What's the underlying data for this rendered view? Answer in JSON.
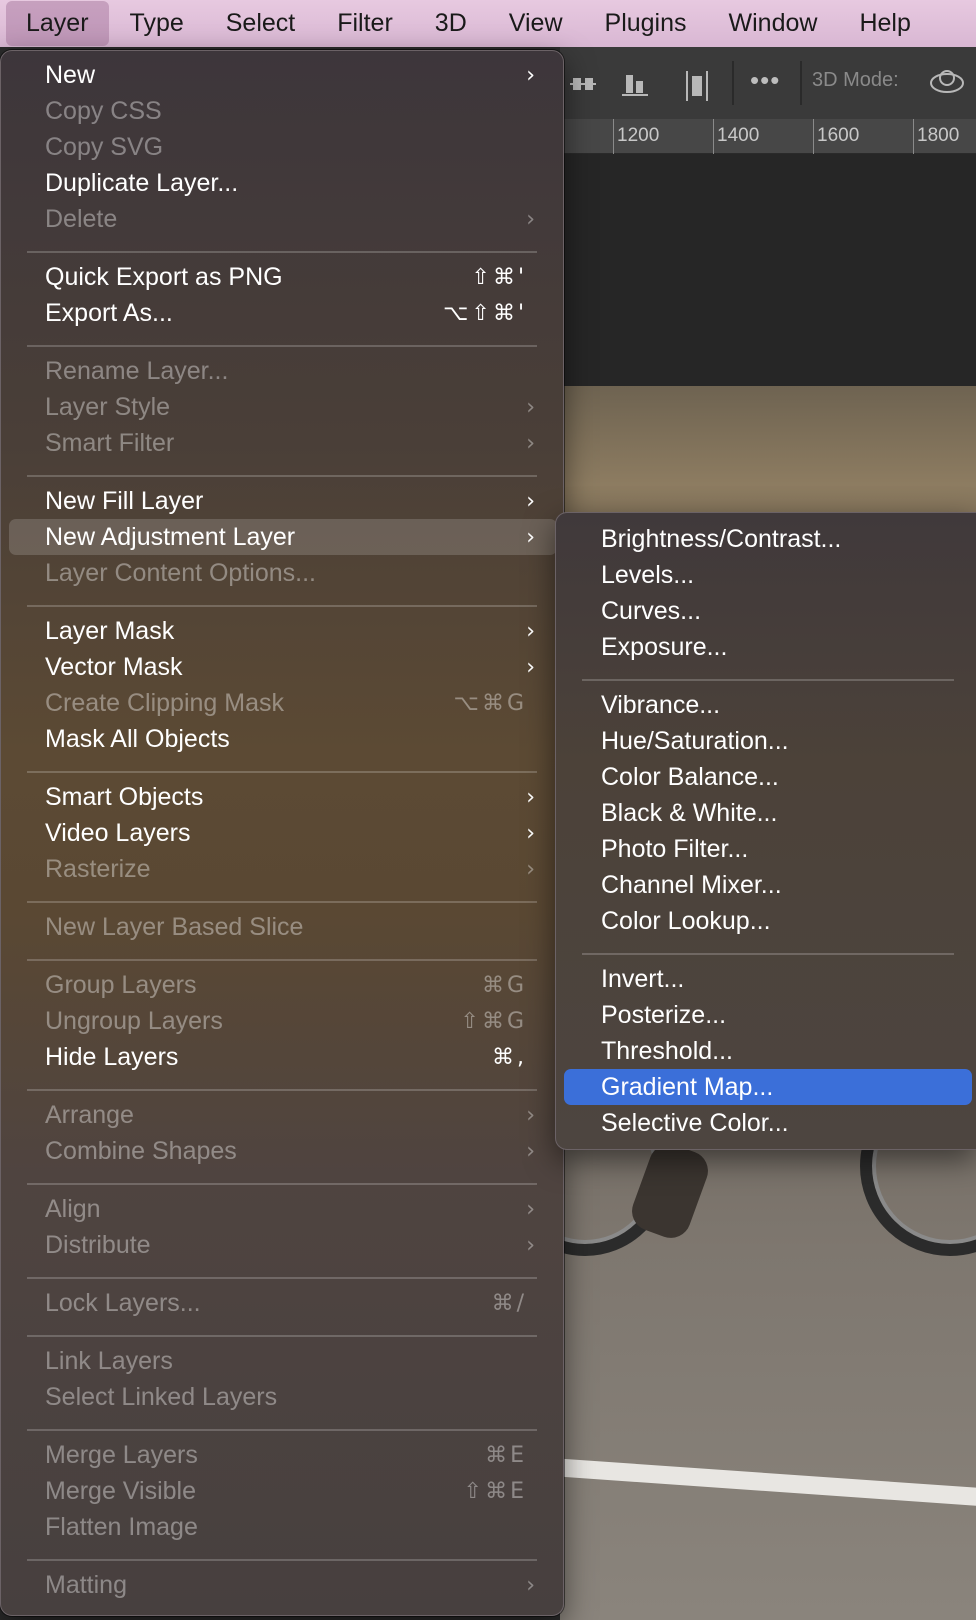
{
  "menubar": {
    "items": [
      {
        "label": "Layer"
      },
      {
        "label": "Type"
      },
      {
        "label": "Select"
      },
      {
        "label": "Filter"
      },
      {
        "label": "3D"
      },
      {
        "label": "View"
      },
      {
        "label": "Plugins"
      },
      {
        "label": "Window"
      },
      {
        "label": "Help"
      }
    ]
  },
  "options_bar": {
    "mode_label": "3D Mode:",
    "more_icon": "•••"
  },
  "ruler": {
    "ticks": [
      "1200",
      "1400",
      "1600",
      "1800"
    ]
  },
  "layer_menu": {
    "items": [
      {
        "label": "New",
        "enabled": true,
        "submenu": true,
        "shortcut": ""
      },
      {
        "label": "Copy CSS",
        "enabled": false,
        "submenu": false,
        "shortcut": ""
      },
      {
        "label": "Copy SVG",
        "enabled": false,
        "submenu": false,
        "shortcut": ""
      },
      {
        "label": "Duplicate Layer...",
        "enabled": true,
        "submenu": false,
        "shortcut": ""
      },
      {
        "label": "Delete",
        "enabled": false,
        "submenu": true,
        "shortcut": ""
      },
      {
        "label": "Quick Export as PNG",
        "enabled": true,
        "submenu": false,
        "shortcut": "⇧⌘'"
      },
      {
        "label": "Export As...",
        "enabled": true,
        "submenu": false,
        "shortcut": "⌥⇧⌘'"
      },
      {
        "label": "Rename Layer...",
        "enabled": false,
        "submenu": false,
        "shortcut": ""
      },
      {
        "label": "Layer Style",
        "enabled": false,
        "submenu": true,
        "shortcut": ""
      },
      {
        "label": "Smart Filter",
        "enabled": false,
        "submenu": true,
        "shortcut": ""
      },
      {
        "label": "New Fill Layer",
        "enabled": true,
        "submenu": true,
        "shortcut": ""
      },
      {
        "label": "New Adjustment Layer",
        "enabled": true,
        "submenu": true,
        "shortcut": "",
        "highlighted": true
      },
      {
        "label": "Layer Content Options...",
        "enabled": false,
        "submenu": false,
        "shortcut": ""
      },
      {
        "label": "Layer Mask",
        "enabled": true,
        "submenu": true,
        "shortcut": ""
      },
      {
        "label": "Vector Mask",
        "enabled": true,
        "submenu": true,
        "shortcut": ""
      },
      {
        "label": "Create Clipping Mask",
        "enabled": false,
        "submenu": false,
        "shortcut": "⌥⌘G"
      },
      {
        "label": "Mask All Objects",
        "enabled": true,
        "submenu": false,
        "shortcut": ""
      },
      {
        "label": "Smart Objects",
        "enabled": true,
        "submenu": true,
        "shortcut": ""
      },
      {
        "label": "Video Layers",
        "enabled": true,
        "submenu": true,
        "shortcut": ""
      },
      {
        "label": "Rasterize",
        "enabled": false,
        "submenu": true,
        "shortcut": ""
      },
      {
        "label": "New Layer Based Slice",
        "enabled": false,
        "submenu": false,
        "shortcut": ""
      },
      {
        "label": "Group Layers",
        "enabled": false,
        "submenu": false,
        "shortcut": "⌘G"
      },
      {
        "label": "Ungroup Layers",
        "enabled": false,
        "submenu": false,
        "shortcut": "⇧⌘G"
      },
      {
        "label": "Hide Layers",
        "enabled": true,
        "submenu": false,
        "shortcut": "⌘,"
      },
      {
        "label": "Arrange",
        "enabled": false,
        "submenu": true,
        "shortcut": ""
      },
      {
        "label": "Combine Shapes",
        "enabled": false,
        "submenu": true,
        "shortcut": ""
      },
      {
        "label": "Align",
        "enabled": false,
        "submenu": true,
        "shortcut": ""
      },
      {
        "label": "Distribute",
        "enabled": false,
        "submenu": true,
        "shortcut": ""
      },
      {
        "label": "Lock Layers...",
        "enabled": false,
        "submenu": false,
        "shortcut": "⌘/"
      },
      {
        "label": "Link Layers",
        "enabled": false,
        "submenu": false,
        "shortcut": ""
      },
      {
        "label": "Select Linked Layers",
        "enabled": false,
        "submenu": false,
        "shortcut": ""
      },
      {
        "label": "Merge Layers",
        "enabled": false,
        "submenu": false,
        "shortcut": "⌘E"
      },
      {
        "label": "Merge Visible",
        "enabled": false,
        "submenu": false,
        "shortcut": "⇧⌘E"
      },
      {
        "label": "Flatten Image",
        "enabled": false,
        "submenu": false,
        "shortcut": ""
      },
      {
        "label": "Matting",
        "enabled": false,
        "submenu": true,
        "shortcut": ""
      }
    ]
  },
  "adjustment_submenu": {
    "items": [
      {
        "label": "Brightness/Contrast..."
      },
      {
        "label": "Levels..."
      },
      {
        "label": "Curves..."
      },
      {
        "label": "Exposure..."
      },
      {
        "label": "Vibrance..."
      },
      {
        "label": "Hue/Saturation..."
      },
      {
        "label": "Color Balance..."
      },
      {
        "label": "Black & White..."
      },
      {
        "label": "Photo Filter..."
      },
      {
        "label": "Channel Mixer..."
      },
      {
        "label": "Color Lookup..."
      },
      {
        "label": "Invert..."
      },
      {
        "label": "Posterize..."
      },
      {
        "label": "Threshold..."
      },
      {
        "label": "Gradient Map...",
        "selected": true
      },
      {
        "label": "Selective Color..."
      }
    ]
  },
  "colors": {
    "selection": "#3b6fd9",
    "menubar_bg": "#e0c0da"
  }
}
